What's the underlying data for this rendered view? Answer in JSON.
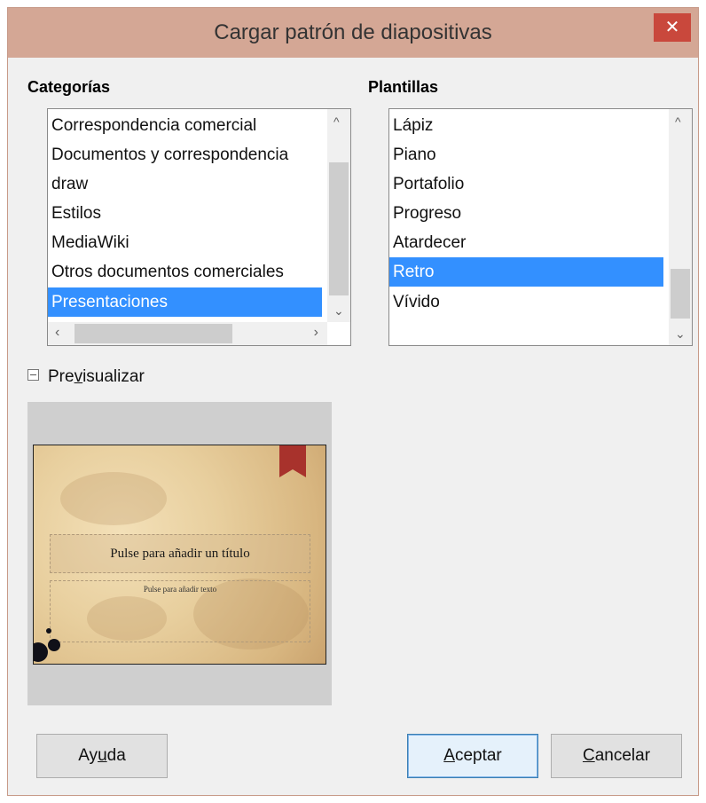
{
  "dialog": {
    "title": "Cargar patrón de diapositivas",
    "close_label": "✕"
  },
  "categories": {
    "heading": "Categorías",
    "items": [
      {
        "label": "Correspondencia comercial",
        "selected": false
      },
      {
        "label": "Documentos y correspondencia",
        "selected": false
      },
      {
        "label": "draw",
        "selected": false
      },
      {
        "label": "Estilos",
        "selected": false
      },
      {
        "label": "MediaWiki",
        "selected": false
      },
      {
        "label": "Otros documentos comerciales",
        "selected": false
      },
      {
        "label": "Presentaciones",
        "selected": true
      }
    ]
  },
  "templates": {
    "heading": "Plantillas",
    "items": [
      {
        "label": "Lápiz",
        "selected": false
      },
      {
        "label": "Piano",
        "selected": false
      },
      {
        "label": "Portafolio",
        "selected": false
      },
      {
        "label": "Progreso",
        "selected": false
      },
      {
        "label": "Atardecer",
        "selected": false
      },
      {
        "label": "Retro",
        "selected": true
      },
      {
        "label": "Vívido",
        "selected": false
      }
    ]
  },
  "preview": {
    "toggle_label_pre": "Pre",
    "toggle_label_mnemonic": "v",
    "toggle_label_post": "isualizar",
    "expanded": true,
    "slide_title_placeholder": "Pulse para añadir un título",
    "slide_text_placeholder": "Pulse para añadir texto"
  },
  "buttons": {
    "help": {
      "pre": "Ay",
      "mnemonic": "u",
      "post": "da"
    },
    "ok": {
      "pre": "",
      "mnemonic": "A",
      "post": "ceptar"
    },
    "cancel": {
      "pre": "",
      "mnemonic": "C",
      "post": "ancelar"
    }
  },
  "colors": {
    "selection": "#3390ff",
    "titlebar": "#d4a795",
    "close": "#c9483c"
  }
}
